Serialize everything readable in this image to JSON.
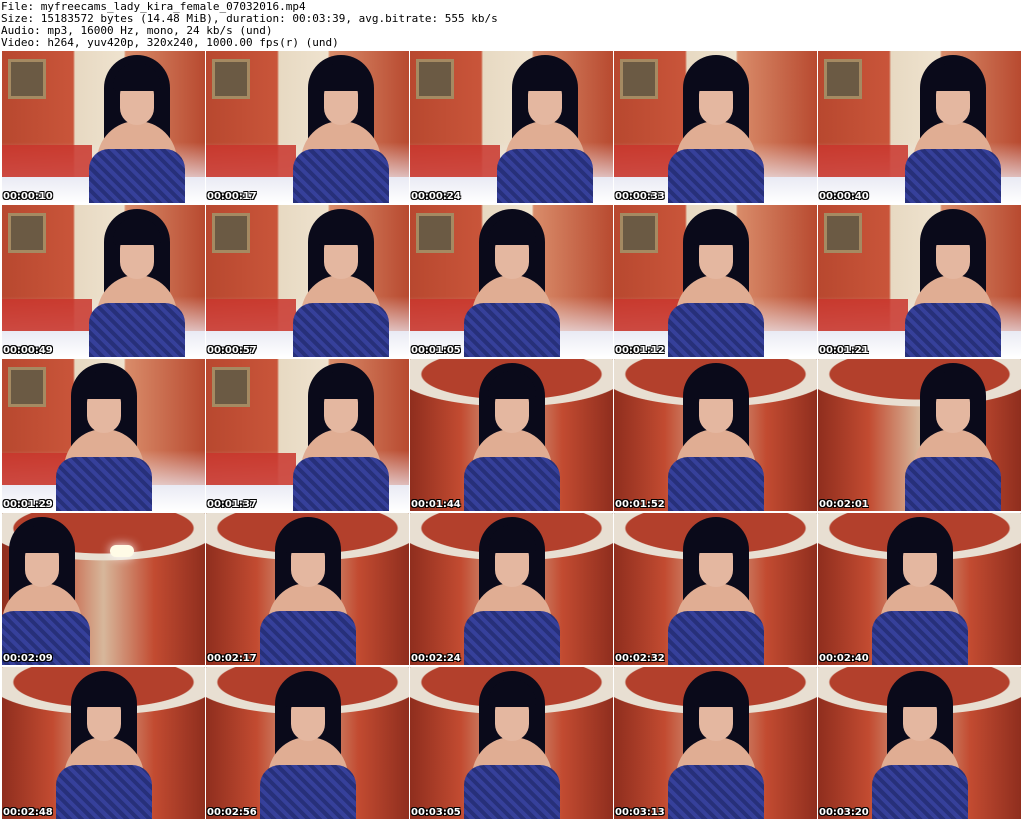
{
  "header": {
    "file_line": "File: myfreecams_lady_kira_female_07032016.mp4",
    "size_line": "Size: 15183572 bytes (14.48 MiB), duration: 00:03:39, avg.bitrate: 555 kb/s",
    "audio_line": "Audio: mp3, 16000 Hz, mono, 24 kb/s (und)",
    "video_line": "Video: h264, yuv420p, 320x240, 1000.00 fps(r) (und)"
  },
  "thumbnails": [
    {
      "timestamp": "00:00:10",
      "scene": "a",
      "pose": "right"
    },
    {
      "timestamp": "00:00:17",
      "scene": "a",
      "pose": "right"
    },
    {
      "timestamp": "00:00:24",
      "scene": "a",
      "pose": "right"
    },
    {
      "timestamp": "00:00:33",
      "scene": "a",
      "pose": "center"
    },
    {
      "timestamp": "00:00:40",
      "scene": "a",
      "pose": "right"
    },
    {
      "timestamp": "00:00:49",
      "scene": "a",
      "pose": "right"
    },
    {
      "timestamp": "00:00:57",
      "scene": "a",
      "pose": "right"
    },
    {
      "timestamp": "00:01:05",
      "scene": "a",
      "pose": "center"
    },
    {
      "timestamp": "00:01:12",
      "scene": "a",
      "pose": "center"
    },
    {
      "timestamp": "00:01:21",
      "scene": "a",
      "pose": "right"
    },
    {
      "timestamp": "00:01:29",
      "scene": "a",
      "pose": "center"
    },
    {
      "timestamp": "00:01:37",
      "scene": "a",
      "pose": "right"
    },
    {
      "timestamp": "00:01:44",
      "scene": "b",
      "pose": "center"
    },
    {
      "timestamp": "00:01:52",
      "scene": "b",
      "pose": "center"
    },
    {
      "timestamp": "00:02:01",
      "scene": "b",
      "pose": "right"
    },
    {
      "timestamp": "00:02:09",
      "scene": "b",
      "pose": "left",
      "lamp": true
    },
    {
      "timestamp": "00:02:17",
      "scene": "b",
      "pose": "center"
    },
    {
      "timestamp": "00:02:24",
      "scene": "b",
      "pose": "center"
    },
    {
      "timestamp": "00:02:32",
      "scene": "b",
      "pose": "center"
    },
    {
      "timestamp": "00:02:40",
      "scene": "b",
      "pose": "center"
    },
    {
      "timestamp": "00:02:48",
      "scene": "b",
      "pose": "center"
    },
    {
      "timestamp": "00:02:56",
      "scene": "b",
      "pose": "center"
    },
    {
      "timestamp": "00:03:05",
      "scene": "b",
      "pose": "center"
    },
    {
      "timestamp": "00:03:13",
      "scene": "b",
      "pose": "center"
    },
    {
      "timestamp": "00:03:20",
      "scene": "b",
      "pose": "center"
    }
  ]
}
